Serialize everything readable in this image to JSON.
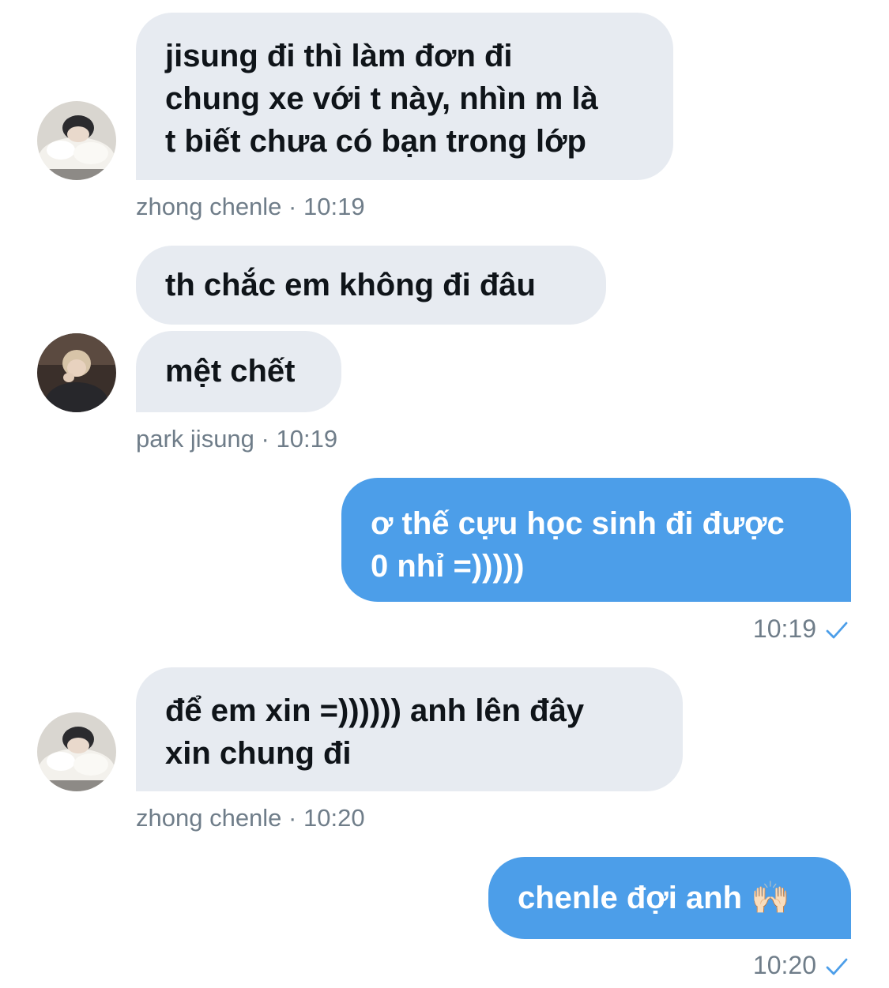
{
  "messages": [
    {
      "sender": "zhong chenle",
      "lines": [
        "jisung đi thì làm đơn đi",
        "chung xe với t này, nhìn m là",
        "t biết chưa có bạn trong lớp"
      ]
    },
    {
      "sender": "park jisung",
      "lines": [
        "th chắc em không đi đâu",
        "mệt chết"
      ]
    },
    {
      "sender": "me",
      "lines": [
        "ơ thế cựu học sinh đi được",
        "0 nhỉ =)))))"
      ]
    },
    {
      "sender": "zhong chenle",
      "lines": [
        "để em xin =)))))) anh lên đây",
        "xin chung đi"
      ]
    },
    {
      "sender": "me",
      "lines": [
        "chenle đợi anh 🙌🏻"
      ]
    }
  ],
  "meta": {
    "m1": {
      "name": "zhong chenle",
      "sep": " · ",
      "time": "10:19"
    },
    "m2": {
      "name": "park jisung",
      "sep": " · ",
      "time": "10:19"
    },
    "m3": {
      "time": "10:19",
      "status_icon": "check-icon"
    },
    "m4": {
      "name": "zhong chenle",
      "sep": " · ",
      "time": "10:20"
    },
    "m5": {
      "time": "10:20",
      "status_icon": "check-icon"
    }
  },
  "avatars": {
    "chenle": "avatar-chenle",
    "jisung": "avatar-jisung"
  },
  "colors": {
    "incoming_bubble": "#e7ebf1",
    "outgoing_bubble": "#4c9ee9",
    "meta_text": "#6f7d89",
    "check": "#4c9ee9"
  }
}
